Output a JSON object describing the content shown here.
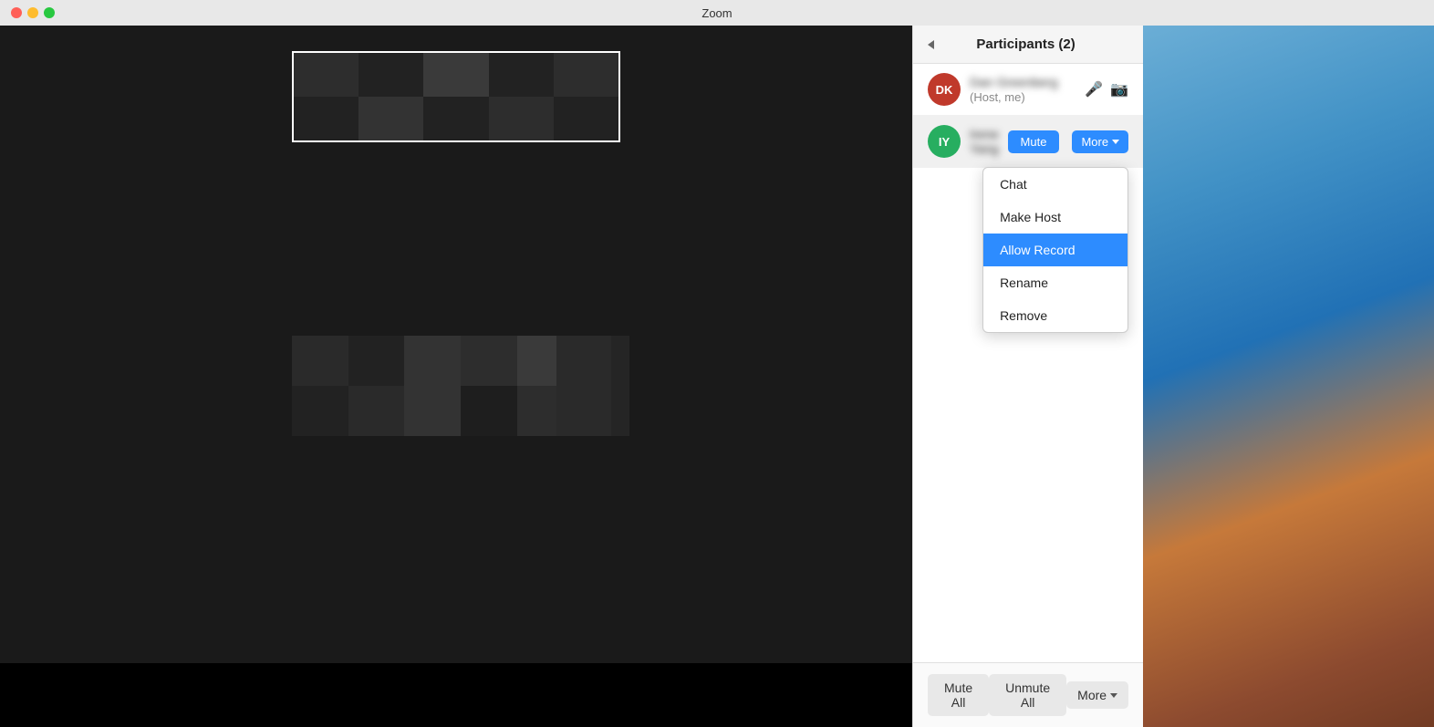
{
  "titleBar": {
    "title": "Zoom"
  },
  "participantsPanel": {
    "title": "Participants (2)",
    "participants": [
      {
        "id": "dk",
        "initials": "DK",
        "avatarClass": "avatar-dk",
        "name": "Dan Greenberg",
        "suffix": "(Host, me)",
        "hasMic": true,
        "hasCamOff": true
      },
      {
        "id": "iy",
        "initials": "IY",
        "avatarClass": "avatar-iy",
        "name": "Irene Yang",
        "suffix": "",
        "hasMute": true,
        "hasMore": true
      }
    ],
    "dropdown": {
      "items": [
        {
          "label": "Chat",
          "active": false
        },
        {
          "label": "Make Host",
          "active": false
        },
        {
          "label": "Allow Record",
          "active": true
        },
        {
          "label": "Rename",
          "active": false
        },
        {
          "label": "Remove",
          "active": false
        }
      ]
    },
    "footer": {
      "muteAll": "Mute All",
      "unmuteAll": "Unmute All",
      "more": "More"
    }
  },
  "buttons": {
    "mute": "Mute",
    "more": "More",
    "chevronDown": "▾"
  }
}
